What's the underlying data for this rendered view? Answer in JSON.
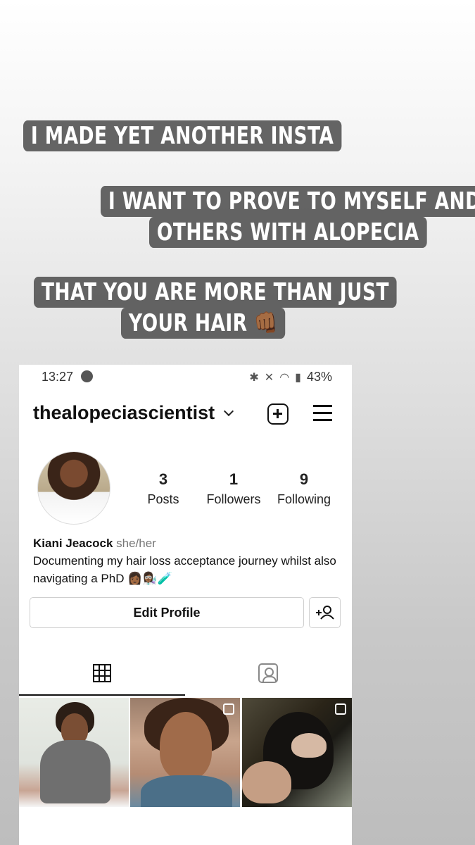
{
  "captions": [
    "I MADE YET ANOTHER INSTA",
    "I WANT TO PROVE TO MYSELF AND",
    "OTHERS WITH ALOPECIA",
    "THAT YOU ARE MORE THAN JUST",
    "YOUR HAIR 👊🏾"
  ],
  "status_bar": {
    "time": "13:27",
    "battery": "43%"
  },
  "profile": {
    "username": "thealopeciascientist",
    "stats": [
      {
        "value": "3",
        "label": "Posts"
      },
      {
        "value": "1",
        "label": "Followers"
      },
      {
        "value": "9",
        "label": "Following"
      }
    ],
    "name": "Kiani Jeacock",
    "pronouns": "she/her",
    "bio": "Documenting my hair loss acceptance journey whilst also navigating a PhD 👩🏾👩🏾‍🔬🧪",
    "edit_label": "Edit Profile"
  },
  "icons": {
    "spotify": "spotify-icon",
    "new_post": "plus-square-icon",
    "menu": "hamburger-menu-icon",
    "add_person": "person-plus-icon",
    "grid": "grid-icon",
    "tagged": "tagged-person-icon"
  },
  "colors": {
    "caption_bg": "#505050",
    "caption_text": "#ffffff"
  }
}
